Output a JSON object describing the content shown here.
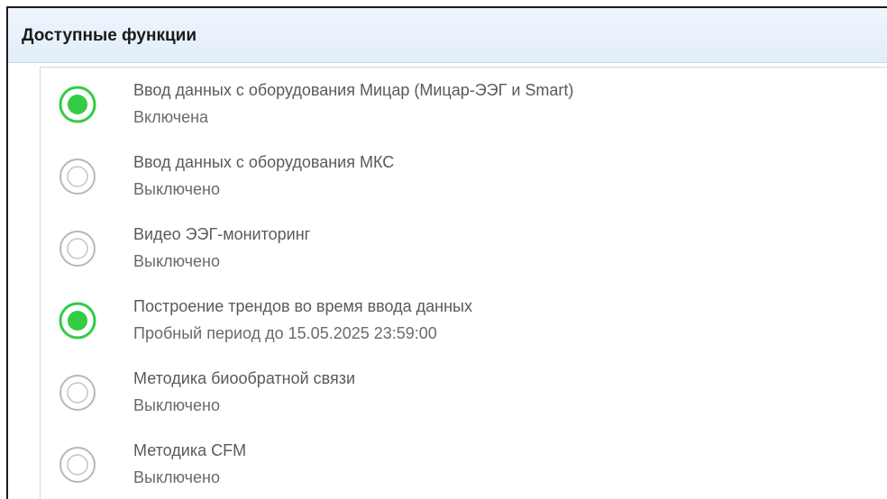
{
  "panel": {
    "title": "Доступные функции"
  },
  "colors": {
    "accent": "#33cc44",
    "inactive": "#b8b8b8",
    "text": "#5a5a5a"
  },
  "features": [
    {
      "title": "Ввод данных с оборудования Мицар (Мицар-ЭЭГ и Smart)",
      "status": "Включена",
      "active": true
    },
    {
      "title": "Ввод данных с оборудования МКС",
      "status": "Выключено",
      "active": false
    },
    {
      "title": "Видео ЭЭГ-мониторинг",
      "status": "Выключено",
      "active": false
    },
    {
      "title": "Построение трендов во время ввода данных",
      "status": "Пробный период до 15.05.2025 23:59:00",
      "active": true
    },
    {
      "title": "Методика биообратной связи",
      "status": "Выключено",
      "active": false
    },
    {
      "title": "Методика CFM",
      "status": "Выключено",
      "active": false
    }
  ]
}
